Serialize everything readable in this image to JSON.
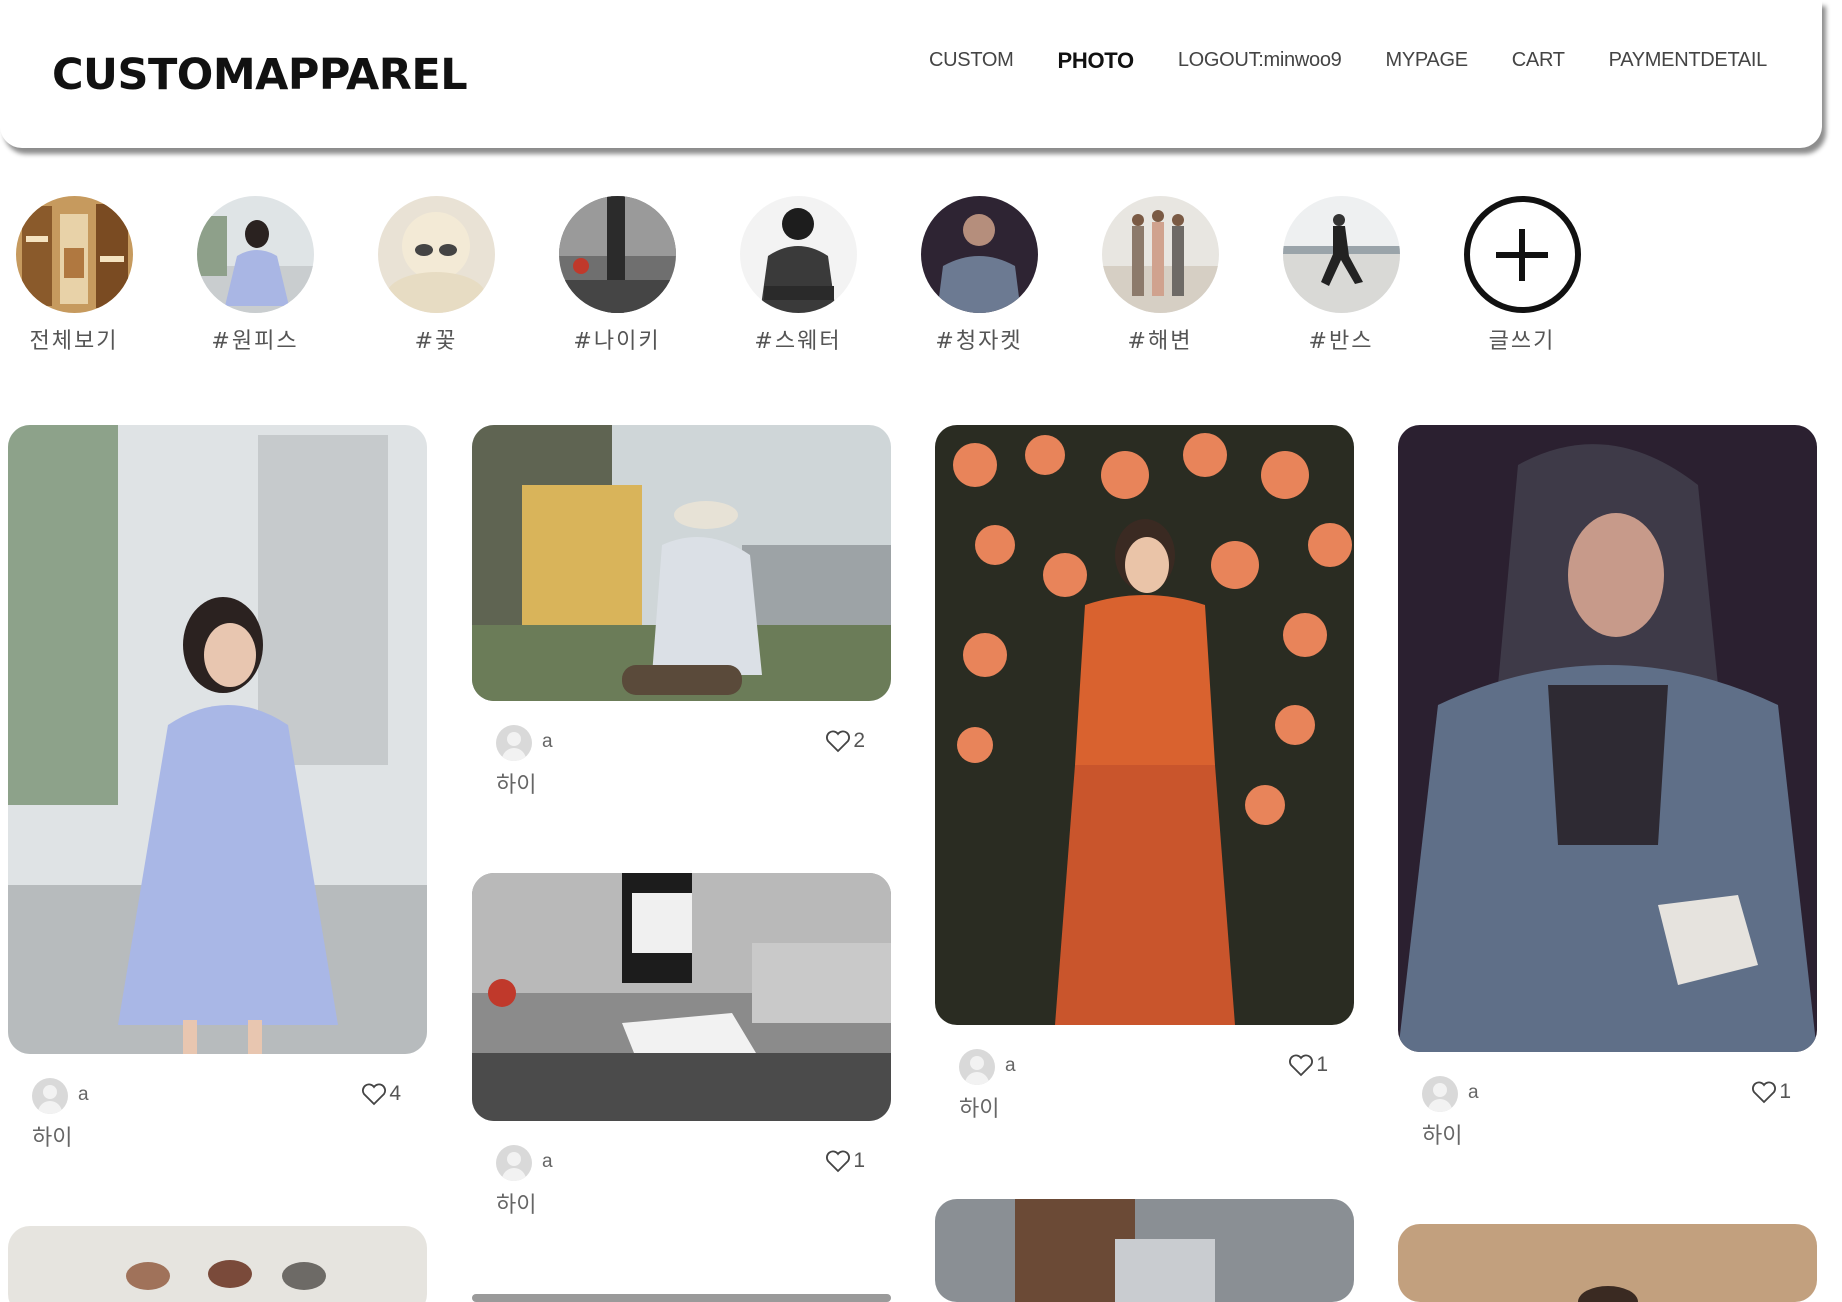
{
  "header": {
    "logo": "CUSTOMAPPAREL",
    "nav": [
      {
        "label": "CUSTOM",
        "active": false
      },
      {
        "label": "PHOTO",
        "active": true
      },
      {
        "label": "LOGOUT:minwoo9",
        "active": false
      },
      {
        "label": "MYPAGE",
        "active": false
      },
      {
        "label": "CART",
        "active": false
      },
      {
        "label": "PAYMENTDETAIL",
        "active": false
      }
    ]
  },
  "stories": [
    {
      "label": "전체보기",
      "icon": "shop-photo"
    },
    {
      "label": "#원피스",
      "icon": "dress-photo"
    },
    {
      "label": "#꽃",
      "icon": "flower-photo"
    },
    {
      "label": "#나이키",
      "icon": "street-photo"
    },
    {
      "label": "#스웨터",
      "icon": "sweater-photo"
    },
    {
      "label": "#청자켓",
      "icon": "denim-photo"
    },
    {
      "label": "#해변",
      "icon": "beach-photo"
    },
    {
      "label": "#반스",
      "icon": "skate-photo"
    },
    {
      "label": "글쓰기",
      "icon": "plus-icon"
    }
  ],
  "posts": [
    {
      "author": "a",
      "caption": "하이",
      "likes": "4"
    },
    {
      "author": "a",
      "caption": "하이",
      "likes": "2"
    },
    {
      "author": "a",
      "caption": "하이",
      "likes": "1"
    },
    {
      "author": "a",
      "caption": "하이",
      "likes": "1"
    },
    {
      "author": "a",
      "caption": "하이",
      "likes": "1"
    }
  ],
  "colors": {
    "text": "#222222",
    "muted": "#666666",
    "accent": "#111111"
  }
}
